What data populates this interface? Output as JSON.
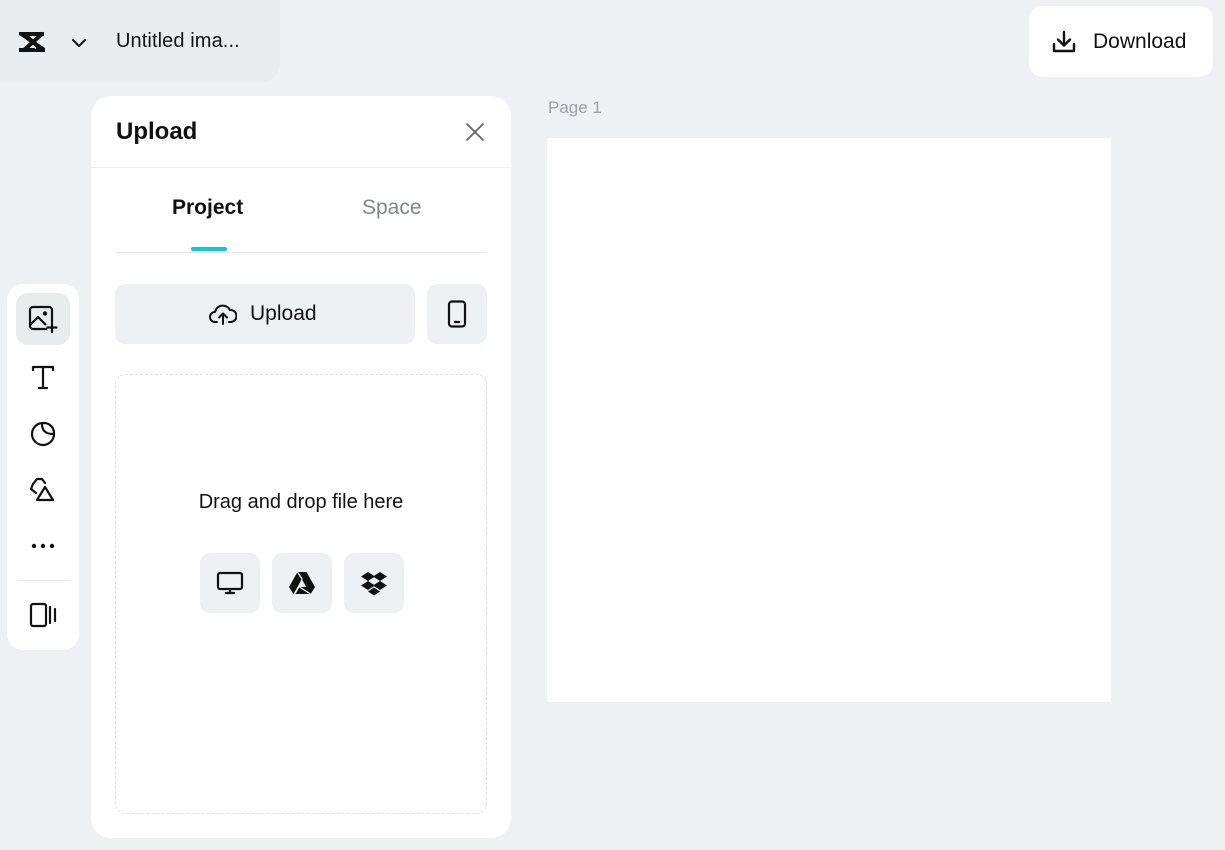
{
  "header": {
    "document_title": "Untitled ima...",
    "download_label": "Download"
  },
  "toolrail": {
    "items": [
      {
        "name": "upload",
        "icon": "image-add-icon",
        "active": true
      },
      {
        "name": "text",
        "icon": "text-icon",
        "active": false
      },
      {
        "name": "elements",
        "icon": "sticker-icon",
        "active": false
      },
      {
        "name": "shapes",
        "icon": "shapes-icon",
        "active": false
      },
      {
        "name": "more",
        "icon": "more-dots-icon",
        "active": false
      },
      {
        "name": "pages",
        "icon": "pages-panel-icon",
        "active": false
      }
    ]
  },
  "upload_panel": {
    "title": "Upload",
    "tabs": [
      {
        "label": "Project",
        "selected": true
      },
      {
        "label": "Space",
        "selected": false
      }
    ],
    "upload_button_label": "Upload",
    "dropzone_text": "Drag and drop file here",
    "sources": [
      "computer-icon",
      "google-drive-icon",
      "dropbox-icon"
    ]
  },
  "canvas": {
    "page_label": "Page 1"
  },
  "colors": {
    "accent": "#14c3dc",
    "background": "#eef1f4",
    "panel": "#ffffff"
  }
}
